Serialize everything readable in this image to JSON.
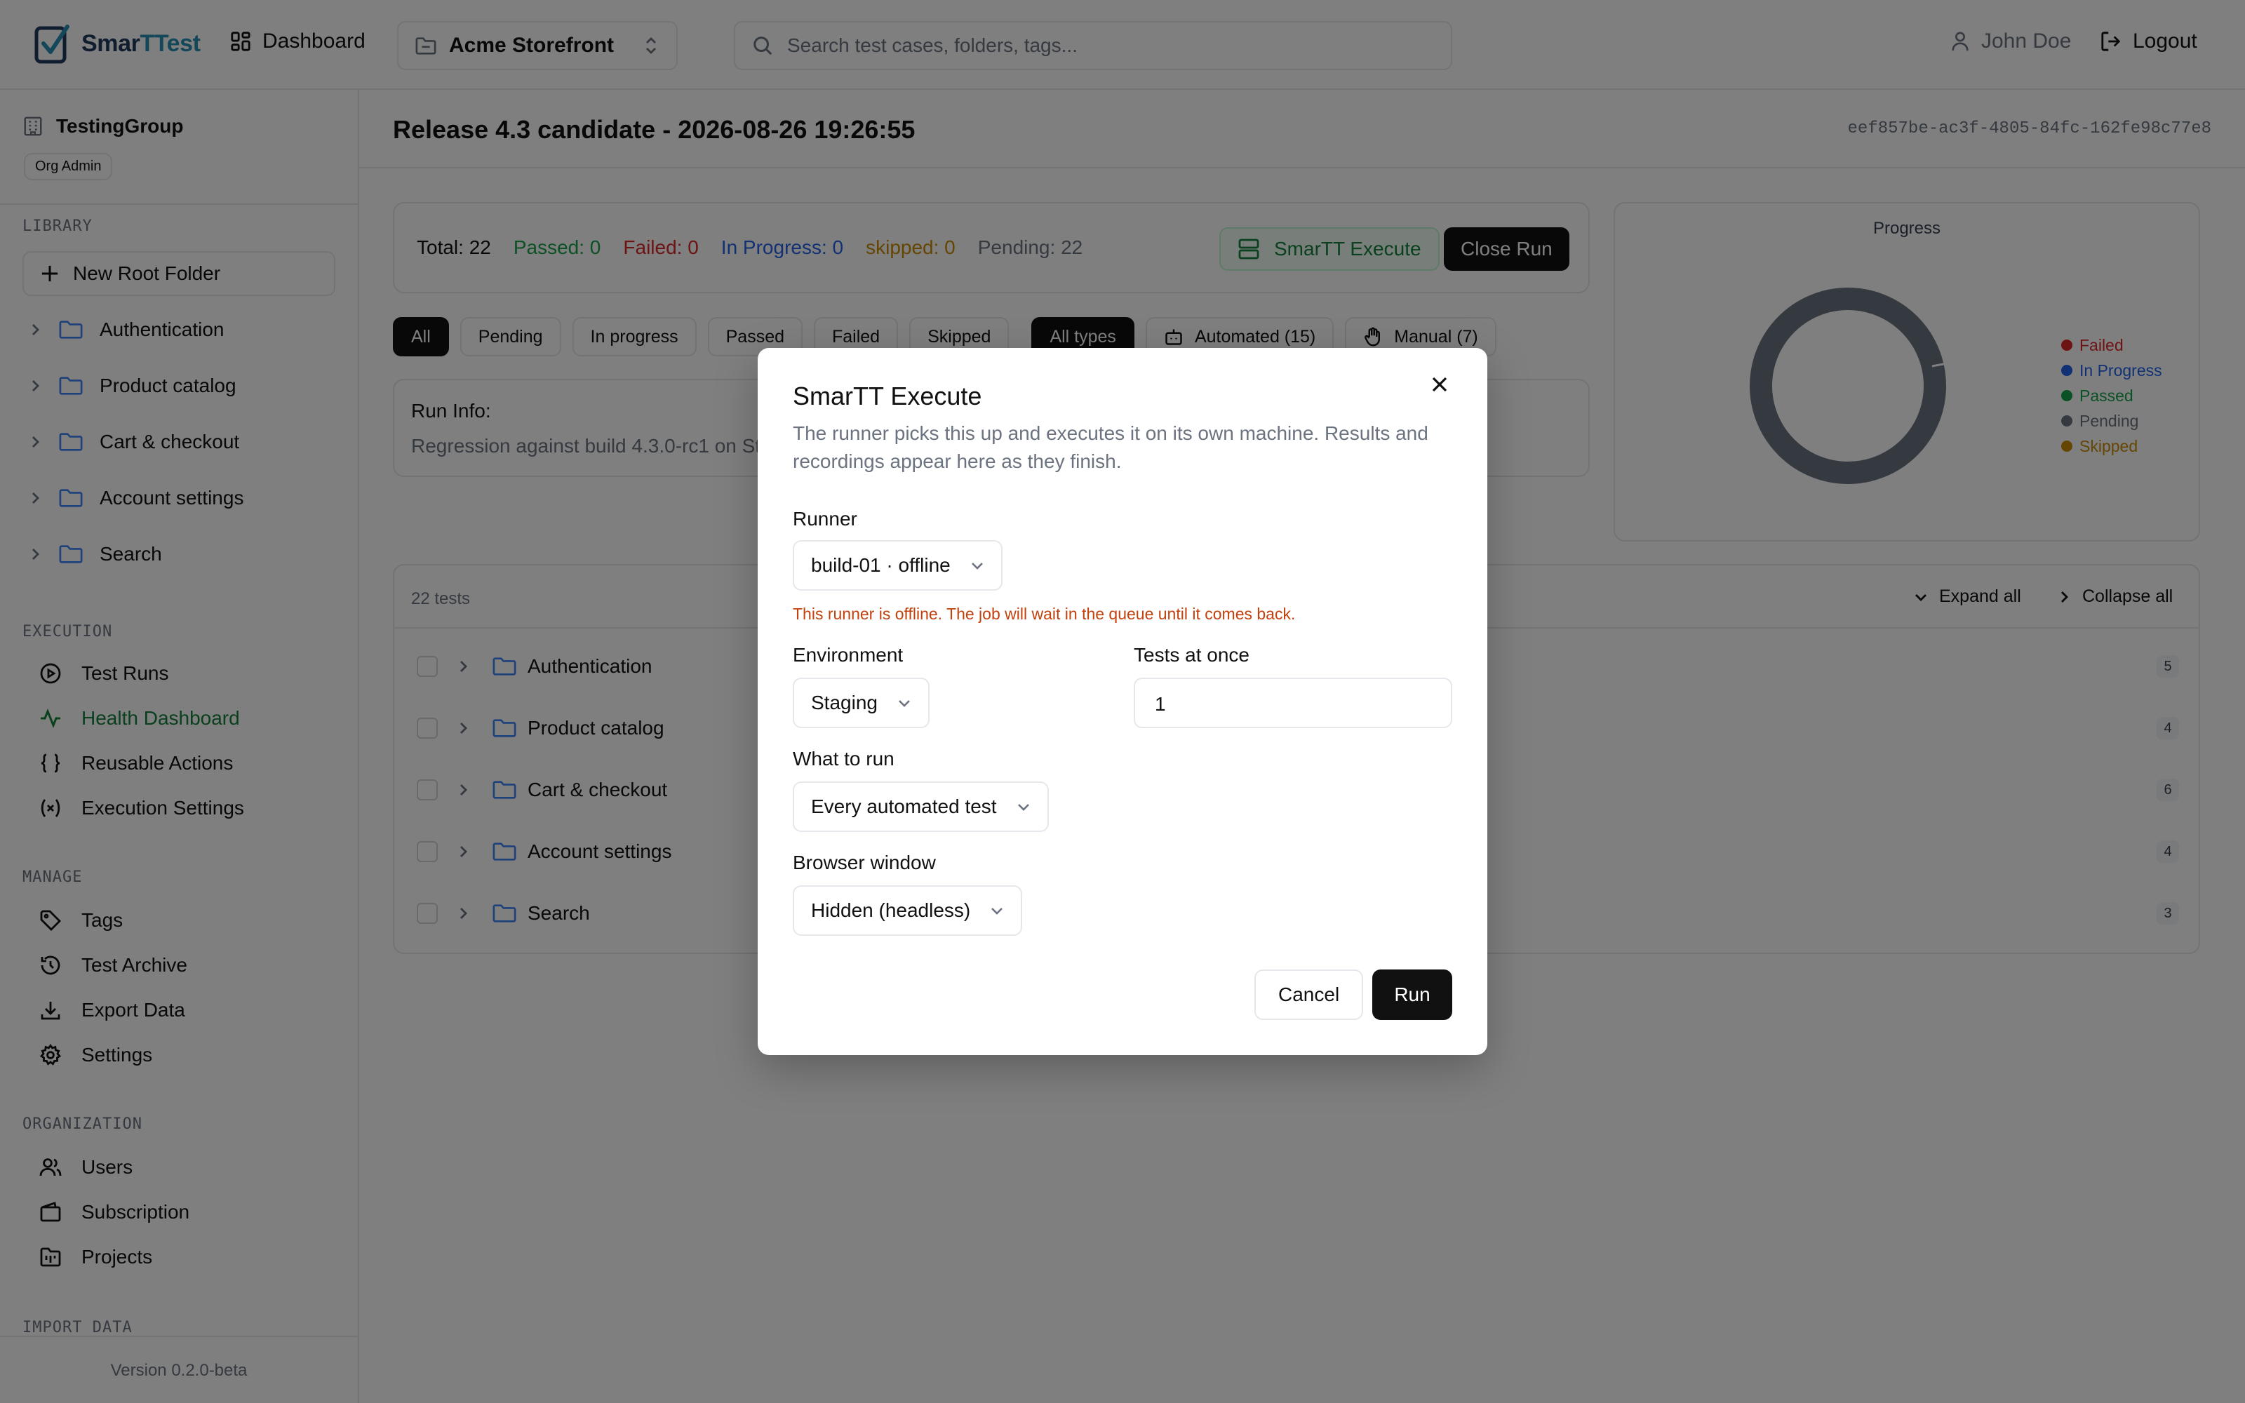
{
  "header": {
    "logo_part1": "Smar",
    "logo_part2": "TTest",
    "dashboard": "Dashboard",
    "project": "Acme Storefront",
    "search_placeholder": "Search test cases, folders, tags...",
    "user": "John Doe",
    "logout": "Logout"
  },
  "sidebar": {
    "org": "TestingGroup",
    "role": "Org Admin",
    "library_title": "LIBRARY",
    "new_root_folder": "New Root Folder",
    "folders": [
      "Authentication",
      "Product catalog",
      "Cart & checkout",
      "Account settings",
      "Search"
    ],
    "execution_title": "EXECUTION",
    "execution": [
      "Test Runs",
      "Health Dashboard",
      "Reusable Actions",
      "Execution Settings"
    ],
    "manage_title": "MANAGE",
    "manage": [
      "Tags",
      "Test Archive",
      "Export Data",
      "Settings"
    ],
    "organization_title": "ORGANIZATION",
    "organization": [
      "Users",
      "Subscription",
      "Projects"
    ],
    "import_title": "IMPORT DATA",
    "version": "Version 0.2.0-beta"
  },
  "run": {
    "title": "Release 4.3 candidate - 2026-08-26 19:26:55",
    "id": "eef857be-ac3f-4805-84fc-162fe98c77e8",
    "stats": {
      "total": "Total: 22",
      "passed": "Passed: 0",
      "failed": "Failed: 0",
      "in_progress": "In Progress: 0",
      "skipped": "skipped: 0",
      "pending": "Pending: 22"
    },
    "execute_button": "SmarTT Execute",
    "close_button": "Close Run",
    "filters": [
      "All",
      "Pending",
      "In progress",
      "Passed",
      "Failed",
      "Skipped"
    ],
    "type_filters": [
      "All types",
      "Automated (15)",
      "Manual (7)"
    ],
    "info_label": "Run Info:",
    "info_text": "Regression against build 4.3.0-rc1 on Sta",
    "tests_count": "22 tests",
    "expand_all": "Expand all",
    "collapse_all": "Collapse all",
    "groups": [
      {
        "name": "Authentication",
        "count": "5"
      },
      {
        "name": "Product catalog",
        "count": "4"
      },
      {
        "name": "Cart & checkout",
        "count": "6"
      },
      {
        "name": "Account settings",
        "count": "4"
      },
      {
        "name": "Search",
        "count": "3"
      }
    ]
  },
  "progress": {
    "title": "Progress",
    "legend": [
      "Failed",
      "In Progress",
      "Passed",
      "Pending",
      "Skipped"
    ],
    "colors": {
      "failed": "#dc2626",
      "in_progress": "#2563eb",
      "passed": "#16a34a",
      "pending": "#6b7280",
      "skipped": "#ca8a04"
    }
  },
  "modal": {
    "title": "SmarTT Execute",
    "description": "The runner picks this up and executes it on its own machine. Results and recordings appear here as they finish.",
    "runner_label": "Runner",
    "runner_value": "build-01 · offline",
    "runner_warning": "This runner is offline. The job will wait in the queue until it comes back.",
    "environment_label": "Environment",
    "environment_value": "Staging",
    "tests_at_once_label": "Tests at once",
    "tests_at_once_value": "1",
    "what_to_run_label": "What to run",
    "what_to_run_value": "Every automated test",
    "browser_label": "Browser window",
    "browser_value": "Hidden (headless)",
    "cancel": "Cancel",
    "run": "Run"
  }
}
